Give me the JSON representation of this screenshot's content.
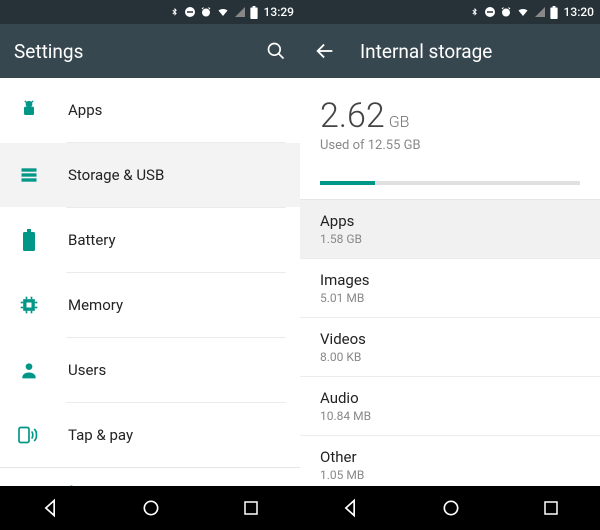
{
  "colors": {
    "accent": "#009688",
    "appbar": "#37474f",
    "status": "#263238"
  },
  "left": {
    "status_time": "13:29",
    "title": "Settings",
    "items": [
      {
        "icon": "android-icon",
        "label": "Apps",
        "selected": false
      },
      {
        "icon": "storage-icon",
        "label": "Storage & USB",
        "selected": true
      },
      {
        "icon": "battery-icon",
        "label": "Battery",
        "selected": false
      },
      {
        "icon": "memory-icon",
        "label": "Memory",
        "selected": false
      },
      {
        "icon": "users-icon",
        "label": "Users",
        "selected": false
      },
      {
        "icon": "tap-pay-icon",
        "label": "Tap & pay",
        "selected": false
      }
    ],
    "section_header": "Personal"
  },
  "right": {
    "status_time": "13:20",
    "title": "Internal storage",
    "used_value": "2.62",
    "used_unit": "GB",
    "used_sub": "Used of 12.55 GB",
    "progress_percent": 21,
    "categories": [
      {
        "name": "Apps",
        "size": "1.58 GB",
        "selected": true
      },
      {
        "name": "Images",
        "size": "5.01 MB",
        "selected": false
      },
      {
        "name": "Videos",
        "size": "8.00 KB",
        "selected": false
      },
      {
        "name": "Audio",
        "size": "10.84 MB",
        "selected": false
      },
      {
        "name": "Other",
        "size": "1.05 MB",
        "selected": false
      }
    ]
  }
}
